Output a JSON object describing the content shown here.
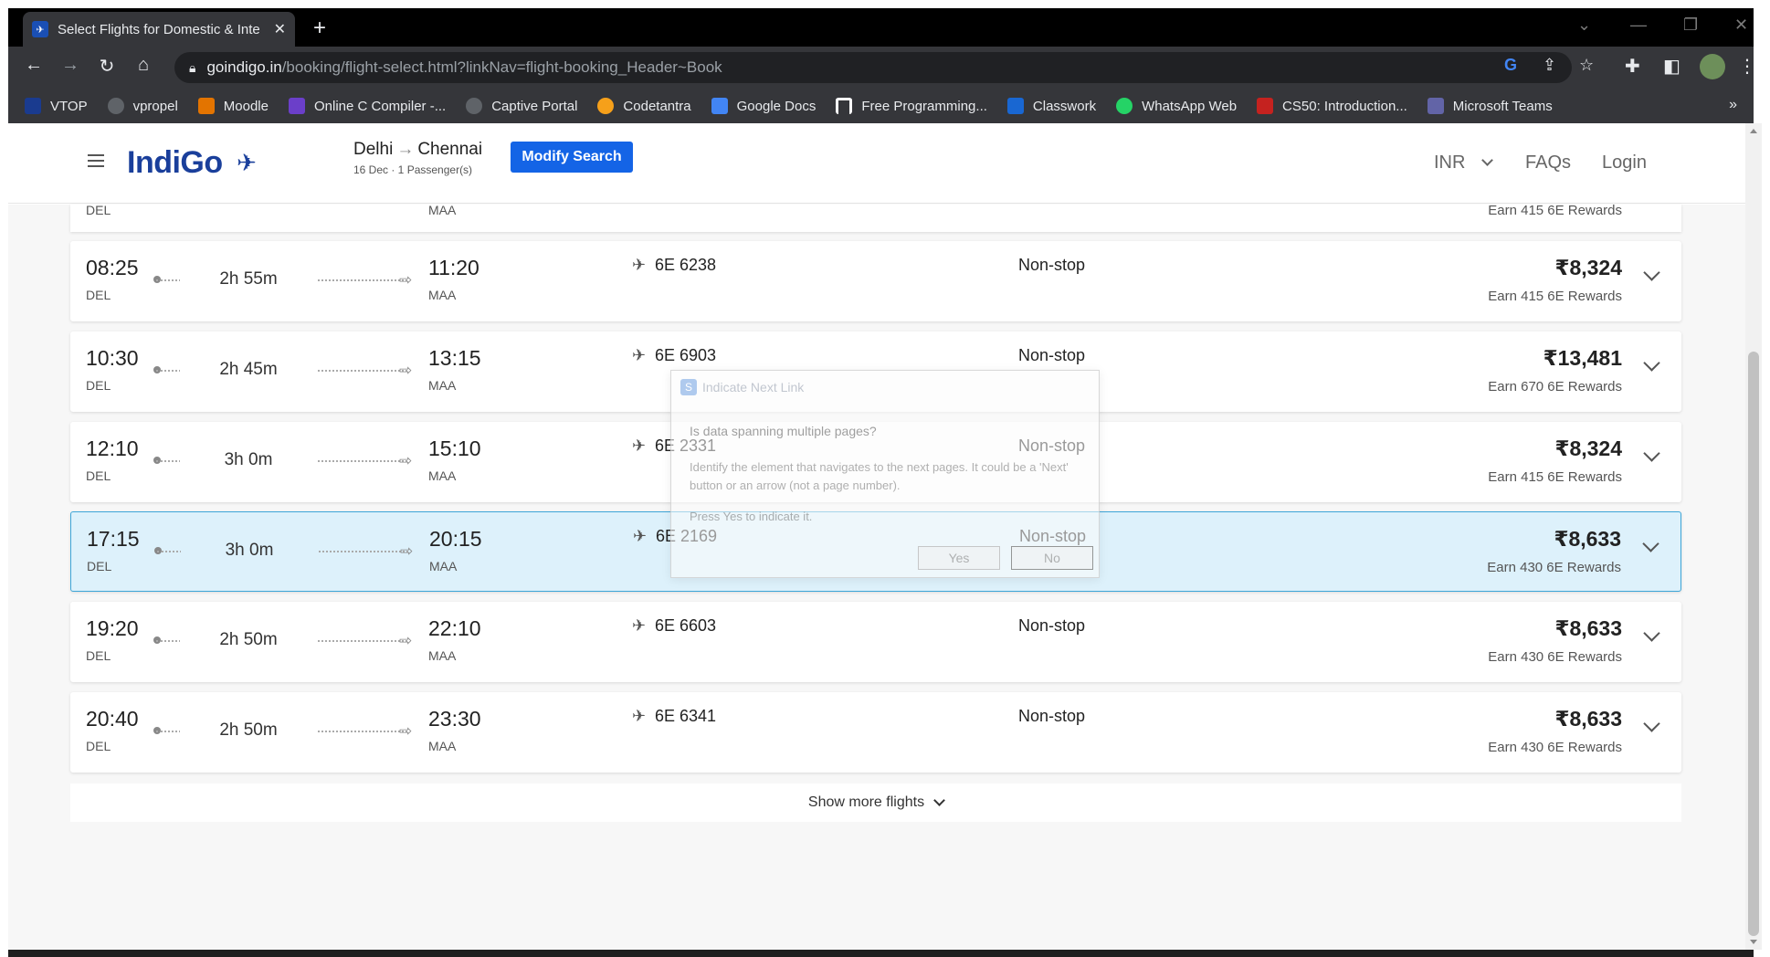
{
  "browser": {
    "tab_title": "Select Flights for Domestic & Inte",
    "new_tab": "+",
    "url_host": "goindigo.in",
    "url_path": "/booking/flight-select.html?linkNav=flight-booking_Header~Book",
    "bookmarks": [
      "VTOP",
      "vpropel",
      "Moodle",
      "Online C Compiler -...",
      "Captive Portal",
      "Codetantra",
      "Google Docs",
      "Free Programming...",
      "Classwork",
      "WhatsApp Web",
      "CS50: Introduction...",
      "Microsoft Teams"
    ],
    "bookmark_colors": [
      "#1a3b8f",
      "#5f6368",
      "#e37400",
      "#6b3fc9",
      "#5f6368",
      "#f6a01a",
      "#4285f4",
      "#ffffff",
      "#1967d2",
      "#25d366",
      "#c5221f",
      "#6264a7"
    ],
    "bookmarks_more": "»"
  },
  "header": {
    "logo": "IndiGo",
    "origin": "Delhi",
    "destination": "Chennai",
    "route_arrow": "→",
    "subtitle": "16 Dec · 1 Passenger(s)",
    "modify_label": "Modify Search",
    "currency": "INR",
    "faqs": "FAQs",
    "login": "Login"
  },
  "partial_row": {
    "dep_code": "DEL",
    "arr_code": "MAA",
    "rewards": "Earn 415 6E Rewards"
  },
  "flights": [
    {
      "dep_time": "08:25",
      "dep_code": "DEL",
      "duration": "2h 55m",
      "arr_time": "11:20",
      "arr_code": "MAA",
      "flight_no": "6E 6238",
      "stops": "Non-stop",
      "price": "₹8,324",
      "rewards": "Earn 415 6E Rewards"
    },
    {
      "dep_time": "10:30",
      "dep_code": "DEL",
      "duration": "2h 45m",
      "arr_time": "13:15",
      "arr_code": "MAA",
      "flight_no": "6E 6903",
      "stops": "Non-stop",
      "price": "₹13,481",
      "rewards": "Earn 670 6E Rewards"
    },
    {
      "dep_time": "12:10",
      "dep_code": "DEL",
      "duration": "3h 0m",
      "arr_time": "15:10",
      "arr_code": "MAA",
      "flight_no": "6E 2331",
      "stops": "Non-stop",
      "price": "₹8,324",
      "rewards": "Earn 415 6E Rewards"
    },
    {
      "dep_time": "17:15",
      "dep_code": "DEL",
      "duration": "3h 0m",
      "arr_time": "20:15",
      "arr_code": "MAA",
      "flight_no": "6E 2169",
      "stops": "Non-stop",
      "price": "₹8,633",
      "rewards": "Earn 430 6E Rewards"
    },
    {
      "dep_time": "19:20",
      "dep_code": "DEL",
      "duration": "2h 50m",
      "arr_time": "22:10",
      "arr_code": "MAA",
      "flight_no": "6E 6603",
      "stops": "Non-stop",
      "price": "₹8,633",
      "rewards": "Earn 430 6E Rewards"
    },
    {
      "dep_time": "20:40",
      "dep_code": "DEL",
      "duration": "2h 50m",
      "arr_time": "23:30",
      "arr_code": "MAA",
      "flight_no": "6E 6341",
      "stops": "Non-stop",
      "price": "₹8,633",
      "rewards": "Earn 430 6E Rewards"
    }
  ],
  "show_more": "Show more flights",
  "dialog": {
    "title": "Indicate Next Link",
    "question": "Is data spanning multiple pages?",
    "body": "Identify the element that navigates to the next pages. It could be a 'Next' button or an arrow (not a page number).",
    "press": "Press Yes to indicate it.",
    "yes": "Yes",
    "no": "No"
  },
  "colors": {
    "brand": "#1a3f9b",
    "accent": "#1464e6",
    "selected_bg": "#ddf1fb",
    "selected_border": "#3ea6d8"
  }
}
